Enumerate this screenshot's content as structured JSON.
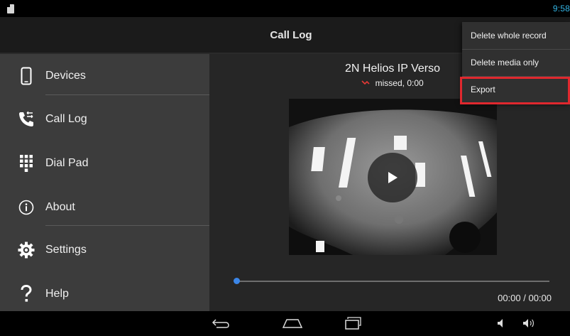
{
  "status_bar": {
    "time": "9:58",
    "icons": [
      "sim-card-icon"
    ]
  },
  "action_bar": {
    "title": "Call Log"
  },
  "drawer": {
    "items": [
      {
        "label": "Devices",
        "icon": "phone-device-icon"
      },
      {
        "label": "Call Log",
        "icon": "call-log-icon"
      },
      {
        "label": "Dial Pad",
        "icon": "dialpad-icon"
      },
      {
        "label": "About",
        "icon": "info-icon"
      },
      {
        "label": "Settings",
        "icon": "gear-icon"
      },
      {
        "label": "Help",
        "icon": "question-icon"
      }
    ]
  },
  "call_detail": {
    "device_name": "2N Helios IP Verso",
    "status": "missed, 0:00",
    "status_icon": "missed-call-icon",
    "playback": {
      "progress": 0,
      "time": "00:00 / 00:00"
    }
  },
  "menu": {
    "items": [
      {
        "label": "Delete whole record"
      },
      {
        "label": "Delete media only"
      },
      {
        "label": "Export",
        "highlighted": true
      }
    ]
  },
  "nav_bar": {
    "buttons": [
      "back-icon",
      "home-icon",
      "recent-apps-icon"
    ],
    "volume_icons": [
      "volume-down-icon",
      "volume-up-icon"
    ]
  },
  "colors": {
    "accent": "#33b5e5",
    "seek": "#3b86e8",
    "missed": "#e53935",
    "highlight": "#e0282e"
  }
}
